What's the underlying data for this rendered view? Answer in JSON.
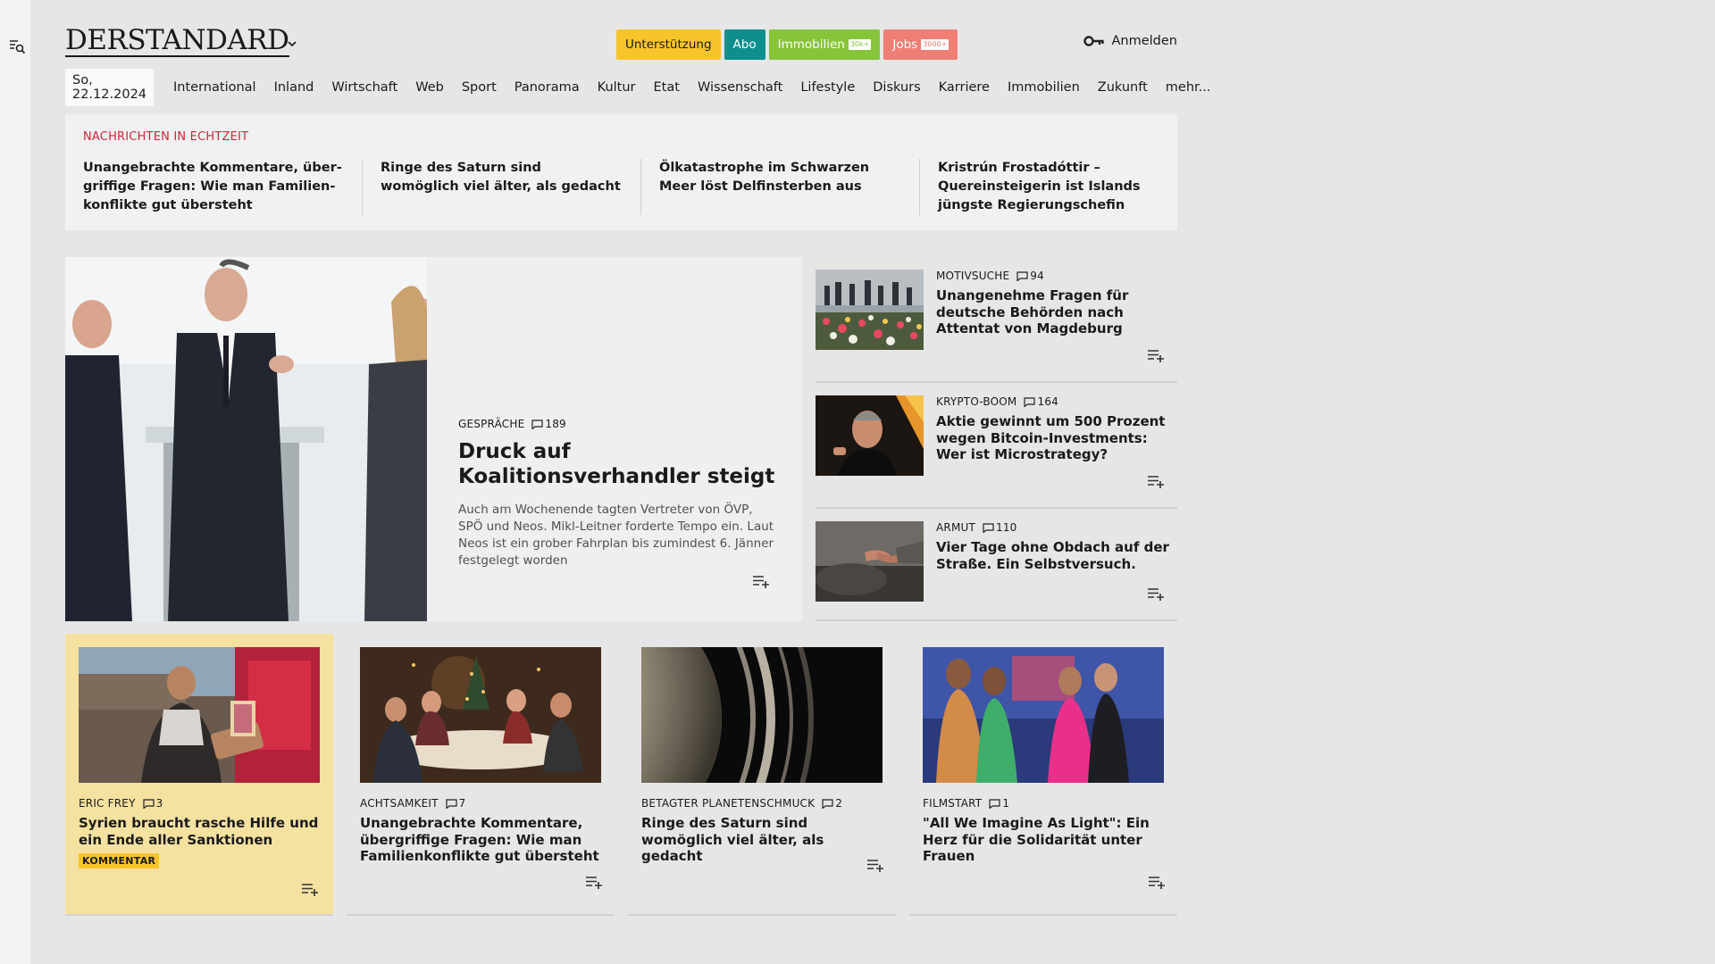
{
  "header": {
    "logo": "DERSTANDARD",
    "pills": {
      "support": "Unterstützung",
      "abo": "Abo",
      "immo": "Immobilien",
      "immo_count": "30k+",
      "jobs": "Jobs",
      "jobs_count": "3000+"
    },
    "login": "Anmelden"
  },
  "nav": {
    "date": "So, 22.12.2024",
    "items": [
      "International",
      "Inland",
      "Wirtschaft",
      "Web",
      "Sport",
      "Panorama",
      "Kultur",
      "Etat",
      "Wissenschaft",
      "Lifestyle",
      "Diskurs",
      "Karriere",
      "Immobilien",
      "Zukunft",
      "mehr..."
    ]
  },
  "realtime": {
    "label": "NACHRICHTEN IN ECHTZEIT",
    "items": [
      "Unangebrachte Kommentare, über­griffige Fragen: Wie man Familien­konflikte gut übersteht",
      "Ringe des Saturn sind womöglich viel älter, als gedacht",
      "Ölkatastrophe im Schwarzen Meer löst Delfinsterben aus",
      "Kristrún Frostadóttir – Quereinsteige­rin ist Islands jüngste Regierungschefin"
    ]
  },
  "lead": {
    "kicker": "GESPRÄCHE",
    "comments": "189",
    "title": "Druck auf Koalitionsverhand­ler steigt",
    "teaser": "Auch am Wochenende tagten Vertreter von ÖVP, SPÖ und Neos. Mikl-Leitner forderte Tempo ein. Laut Neos ist ein grober Fahrplan bis zumindest 6. Jänner festgelegt worden"
  },
  "side": [
    {
      "kicker": "MOTIVSUCHE",
      "comments": "94",
      "title": "Unangenehme Fragen für deutsche Behörden nach Attentat von Magdeburg"
    },
    {
      "kicker": "KRYPTO-BOOM",
      "comments": "164",
      "title": "Aktie gewinnt um 500 Prozent wegen Bitcoin-Investments: Wer ist Microstrategy?"
    },
    {
      "kicker": "ARMUT",
      "comments": "110",
      "title": "Vier Tage ohne Obdach auf der Straße. Ein Selbstversuch."
    }
  ],
  "cards": [
    {
      "kicker": "ERIC FREY",
      "comments": "3",
      "title": "Syrien braucht rasche Hilfe und ein Ende aller Sanktionen",
      "badge": "KOMMENTAR"
    },
    {
      "kicker": "ACHTSAMKEIT",
      "comments": "7",
      "title": "Unangebrachte Kommentare, übergriffige Fragen: Wie man Fa­milienkonflikte gut übersteht"
    },
    {
      "kicker": "BETAGTER PLANETENSCHMUCK",
      "comments": "2",
      "title": "Ringe des Saturn sind womöglich viel älter, als gedacht"
    },
    {
      "kicker": "FILMSTART",
      "comments": "1",
      "title": "\"All We Imagine As Light\": Ein Herz für die Solidarität unter Frauen"
    }
  ],
  "colors": {
    "realtime_label": "#d0243a",
    "support": "#f7c52b",
    "abo": "#0e8e8e",
    "immo": "#86c43a",
    "jobs": "#ef7e74",
    "comment_card": "#f5e1a0"
  }
}
